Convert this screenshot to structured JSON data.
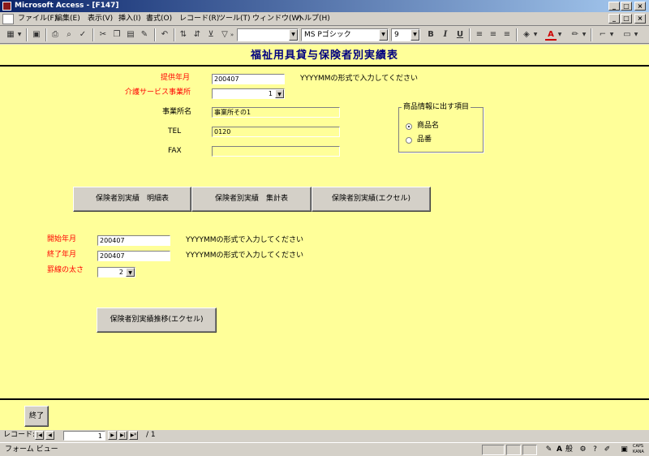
{
  "window": {
    "title": "Microsoft Access - [F147]"
  },
  "menubar": {
    "items": [
      "ファイル(F)",
      "編集(E)",
      "表示(V)",
      "挿入(I)",
      "書式(O)",
      "レコード(R)",
      "ツール(T)",
      "ウィンドウ(W)",
      "ヘルプ(H)"
    ]
  },
  "toolbar": {
    "font_name": "MS Pゴシック",
    "font_size": "9",
    "bold": "B",
    "italic": "I",
    "underline": "U"
  },
  "form": {
    "title": "福祉用具貸与保険者別実績表",
    "provide_month": {
      "label": "提供年月",
      "value": "200407",
      "hint": "YYYYMMの形式で入力してください"
    },
    "office": {
      "label": "介護サービス事業所",
      "value": "1"
    },
    "office_name": {
      "label": "事業所名",
      "value": "事業所その1"
    },
    "tel": {
      "label": "TEL",
      "value": "0120"
    },
    "fax": {
      "label": "FAX",
      "value": ""
    },
    "product_group": {
      "title": "商品情報に出す項目",
      "options": [
        "商品名",
        "品番"
      ],
      "selected": 0
    },
    "buttons": {
      "detail": "保険者別実績　明細表",
      "summary": "保険者別実績　集計表",
      "excel": "保険者別実績(エクセル)",
      "trend": "保険者別実績推移(エクセル)",
      "end": "終了"
    },
    "start_month": {
      "label": "開始年月",
      "value": "200407",
      "hint": "YYYYMMの形式で入力してください"
    },
    "end_month": {
      "label": "終了年月",
      "value": "200407",
      "hint": "YYYYMMの形式で入力してください"
    },
    "line_width": {
      "label": "罫線の太さ",
      "value": "2"
    }
  },
  "navbar": {
    "label": "レコード:",
    "current": "1",
    "total": "/ 1"
  },
  "statusbar": {
    "text": "フォーム ビュー",
    "ime": "般",
    "caps": "CAPS",
    "kana": "KANA"
  },
  "colors": {
    "form_bg": "#ffff99",
    "title_text": "#000080",
    "required_label": "#ff0000",
    "titlebar": "#0a246a"
  }
}
